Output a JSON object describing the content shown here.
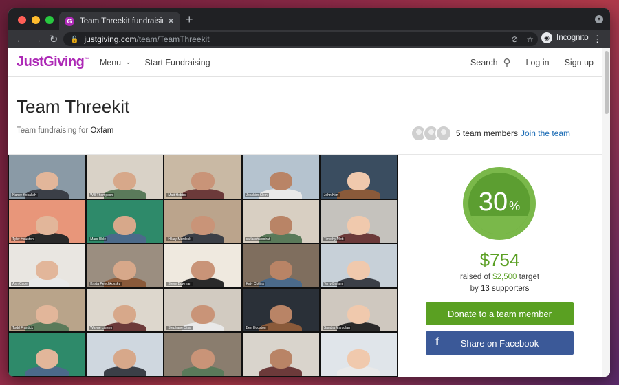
{
  "browser": {
    "tab_title": "Team Threekit fundraising for O",
    "url_host": "justgiving.com",
    "url_path": "/team/TeamThreekit",
    "profile_label": "Incognito",
    "traffic_colors": [
      "#ff5f57",
      "#febc2e",
      "#28c840"
    ]
  },
  "site_header": {
    "logo": "JustGiving",
    "menu_label": "Menu",
    "start_label": "Start Fundraising",
    "search_label": "Search",
    "login_label": "Log in",
    "signup_label": "Sign up"
  },
  "page": {
    "title": "Team Threekit",
    "subtitle_prefix": "Team fundraising for",
    "charity": "Oxfam",
    "members_text": "5 team members",
    "join_label": "Join the team"
  },
  "participants": [
    "Nancy Kokallah",
    "Will Thompson",
    "Matt Hobbs",
    "Joachim Klein",
    "John Kim",
    "Tyler Houston",
    "Marc Uble",
    "Hilary Murdock",
    "carlaschwoolrat",
    "Timothy Mott",
    "Ash Cade",
    "Krista Penchkovsky",
    "Steve Bowman",
    "Katy Collins",
    "Terry Bream",
    "Todd Frantick",
    "Wayne Larsen",
    "Stephane Ottar",
    "Ben Houston",
    "Sandra Marsolan",
    "",
    "",
    "",
    "",
    ""
  ],
  "progress": {
    "percent": 30,
    "percent_sign": "%",
    "raised": "$754",
    "raised_prefix": "raised of",
    "target_amount": "$2,500",
    "target_suffix": "target",
    "supporters_prefix": "by",
    "supporters_count": "13 supporters"
  },
  "actions": {
    "donate_label": "Donate to a team member",
    "share_label": "Share on Facebook"
  },
  "colors": {
    "brand": "#ad29b6",
    "green": "#5aa022",
    "facebook": "#3b5998"
  }
}
